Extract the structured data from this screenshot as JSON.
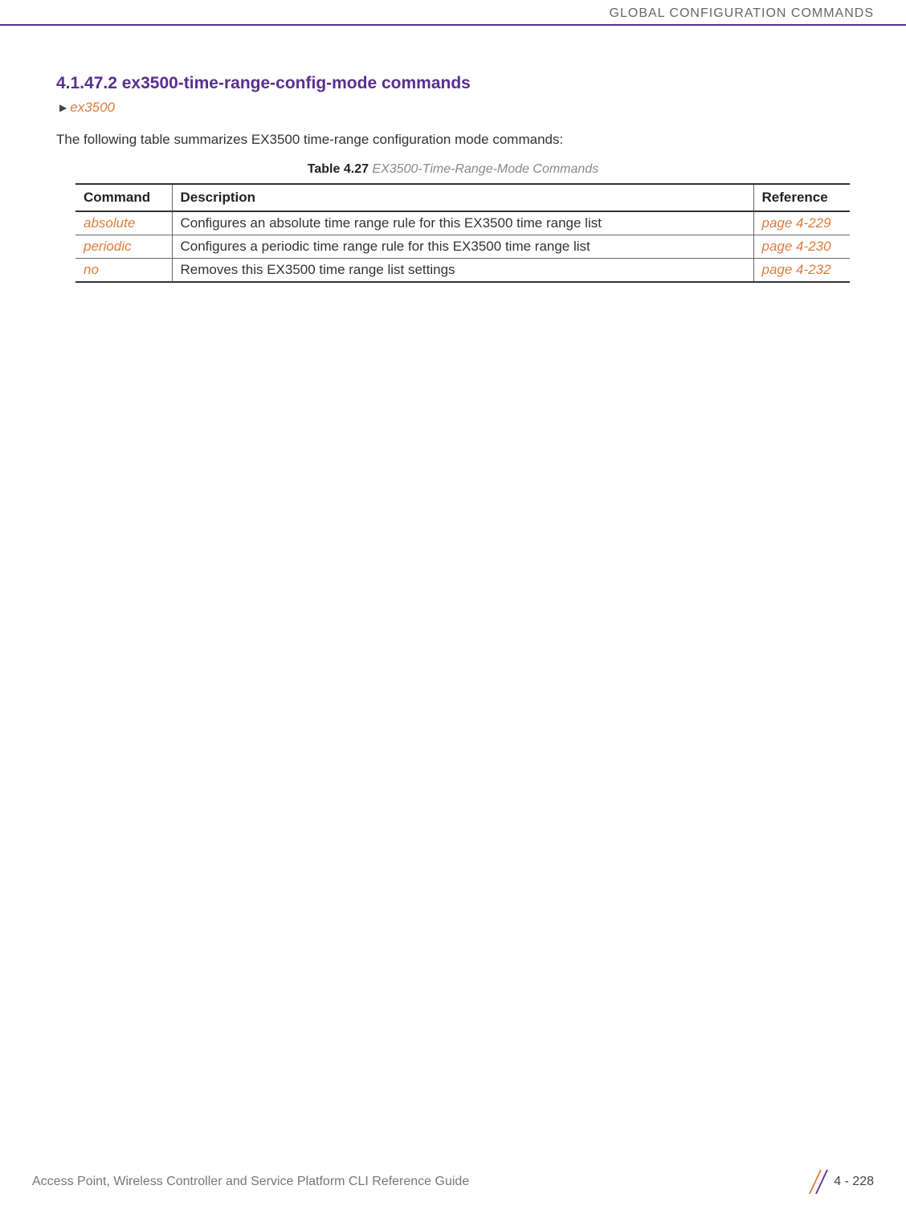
{
  "header": {
    "chapter_title": "GLOBAL CONFIGURATION COMMANDS"
  },
  "section": {
    "heading": "4.1.47.2 ex3500-time-range-config-mode commands",
    "breadcrumb_link": "ex3500",
    "intro": "The following table summarizes EX3500 time-range configuration mode commands:"
  },
  "table": {
    "caption_label": "Table 4.27",
    "caption_title": " EX3500-Time-Range-Mode Commands",
    "headers": {
      "command": "Command",
      "description": "Description",
      "reference": "Reference"
    },
    "rows": [
      {
        "command": "absolute",
        "description": "Configures an absolute time range rule for this EX3500 time range list",
        "reference": "page 4-229"
      },
      {
        "command": "periodic",
        "description": "Configures a periodic time range rule for this EX3500 time range list",
        "reference": "page 4-230"
      },
      {
        "command": "no",
        "description": "Removes this EX3500 time range list settings",
        "reference": "page 4-232"
      }
    ]
  },
  "footer": {
    "doc_title": "Access Point, Wireless Controller and Service Platform CLI Reference Guide",
    "page_number": "4 - 228"
  }
}
